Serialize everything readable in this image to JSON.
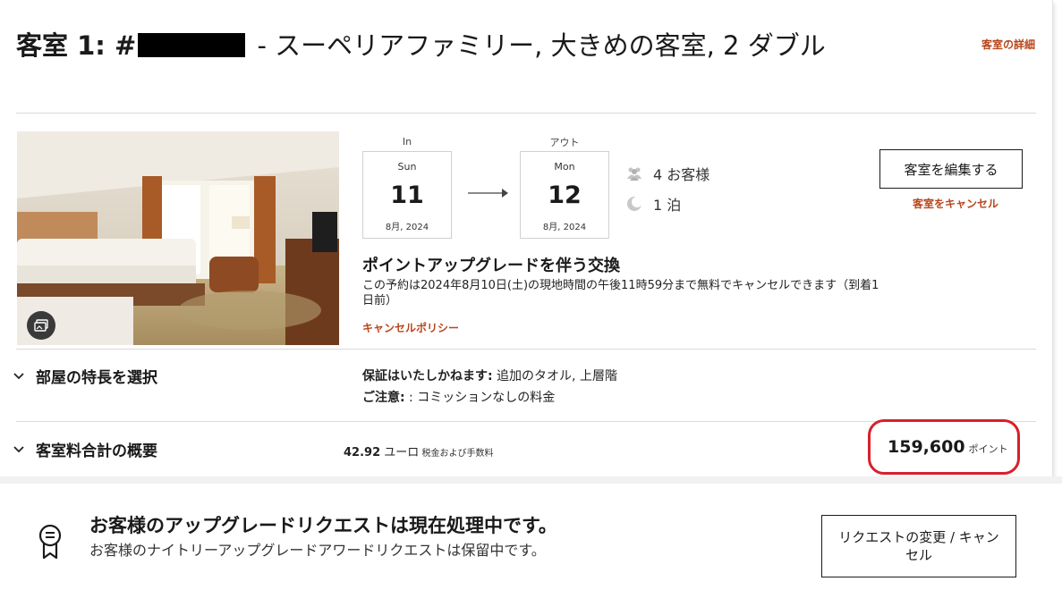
{
  "room": {
    "title_prefix": "客室 1: #",
    "title_rest": " - スーペリアファミリー, 大きめの客室, 2 ダブル",
    "details_link": "客室の詳細"
  },
  "stay": {
    "checkin_label": "In",
    "checkout_label": "アウト",
    "checkin": {
      "dow": "Sun",
      "day": "11",
      "ym": "8月, 2024"
    },
    "checkout": {
      "dow": "Mon",
      "day": "12",
      "ym": "8月, 2024"
    },
    "guests": "4 お客様",
    "nights": "1 泊"
  },
  "actions": {
    "edit_room": "客室を編集する",
    "cancel_room": "客室をキャンセル"
  },
  "rate": {
    "name": "ポイントアップグレードを伴う交換",
    "cancel_note": "この予約は2024年8月10日(土)の現地時間の午後11時59分まで無料でキャンセルできます（到着1日前）",
    "policy_link": "キャンセルポリシー"
  },
  "features": {
    "section_title": "部屋の特長を選択",
    "guaranteed_label": "保証はいたしかねます:",
    "guaranteed_value": " 追加のタオル, 上層階",
    "note_label": "ご注意:",
    "note_value": " : コミッションなしの料金"
  },
  "summary": {
    "section_title": "客室料合計の概要",
    "eur_amount": "42.92",
    "eur_unit": " ユーロ",
    "eur_note": " 税金および手数料",
    "points": "159,600",
    "points_unit": "ポイント"
  },
  "upgrade_notice": {
    "title": "お客様のアップグレードリクエストは現在処理中です。",
    "text": "お客様のナイトリーアップグレードアワードリクエストは保留中です。",
    "button": "リクエストの変更 / キャンセル"
  },
  "colors": {
    "accent": "#b8461b",
    "highlight_circle": "#d8202a"
  }
}
